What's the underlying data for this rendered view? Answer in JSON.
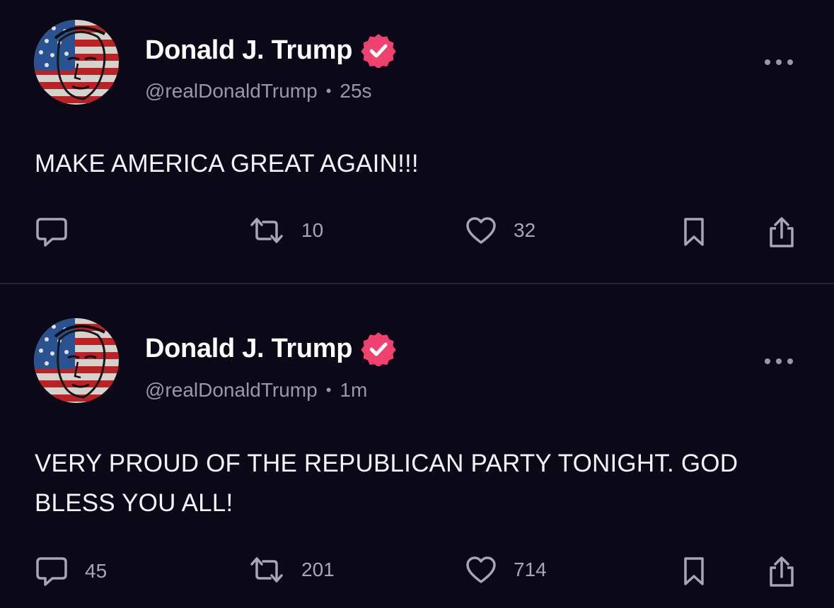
{
  "colors": {
    "background": "#0b0818",
    "verified_badge": "#f0426e",
    "muted_text": "#9a97a6",
    "body_text": "#f4f3f7"
  },
  "posts": [
    {
      "author_name": "Donald J. Trump",
      "handle": "@realDonaldTrump",
      "separator": "•",
      "time": "25s",
      "text": "MAKE AMERICA GREAT AGAIN!!!",
      "reply_count": "",
      "repost_count": "10",
      "like_count": "32",
      "icons": [
        "avatar",
        "verified-badge-icon",
        "more-options-icon",
        "reply-icon",
        "repost-icon",
        "like-icon",
        "bookmark-icon",
        "share-icon"
      ]
    },
    {
      "author_name": "Donald J. Trump",
      "handle": "@realDonaldTrump",
      "separator": "•",
      "time": "1m",
      "text": "VERY PROUD OF THE REPUBLICAN PARTY TONIGHT. GOD BLESS YOU ALL!",
      "reply_count": "45",
      "repost_count": "201",
      "like_count": "714",
      "icons": [
        "avatar",
        "verified-badge-icon",
        "more-options-icon",
        "reply-icon",
        "repost-icon",
        "like-icon",
        "bookmark-icon",
        "share-icon"
      ]
    }
  ]
}
